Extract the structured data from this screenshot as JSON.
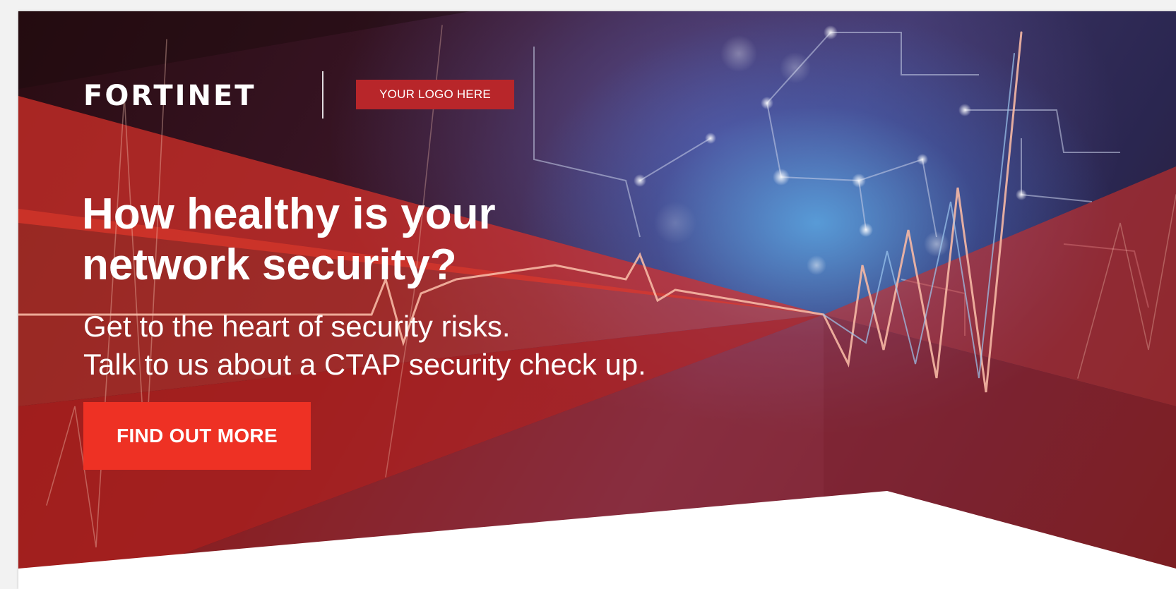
{
  "brand": {
    "wordmark": "FORTINET",
    "logo_placeholder": "YOUR LOGO HERE"
  },
  "hero": {
    "headline_line1": "How healthy is your",
    "headline_line2": "network security?",
    "subhead_line1": "Get to the heart of security risks.",
    "subhead_line2": "Talk to us about a CTAP security check up.",
    "cta_label": "FIND OUT MORE"
  },
  "colors": {
    "brand_red": "#ee3124",
    "deep_red": "#b8262a",
    "text_white": "#ffffff",
    "accent_blue": "#5aaae6"
  }
}
